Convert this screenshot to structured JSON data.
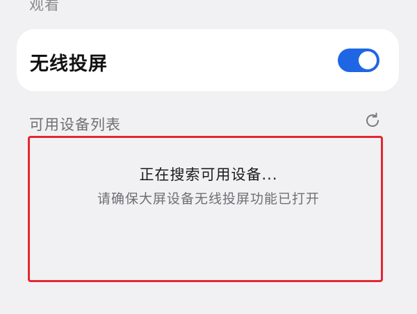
{
  "section": {
    "previous_label": "观看"
  },
  "wireless_projection": {
    "label": "无线投屏",
    "toggle_on": true,
    "toggle_color": "#1f66e5"
  },
  "device_list": {
    "title": "可用设备列表",
    "refresh_icon": "refresh-icon",
    "search_status": "正在搜索可用设备...",
    "search_hint": "请确保大屏设备无线投屏功能已打开",
    "highlight_color": "#e5262f"
  }
}
